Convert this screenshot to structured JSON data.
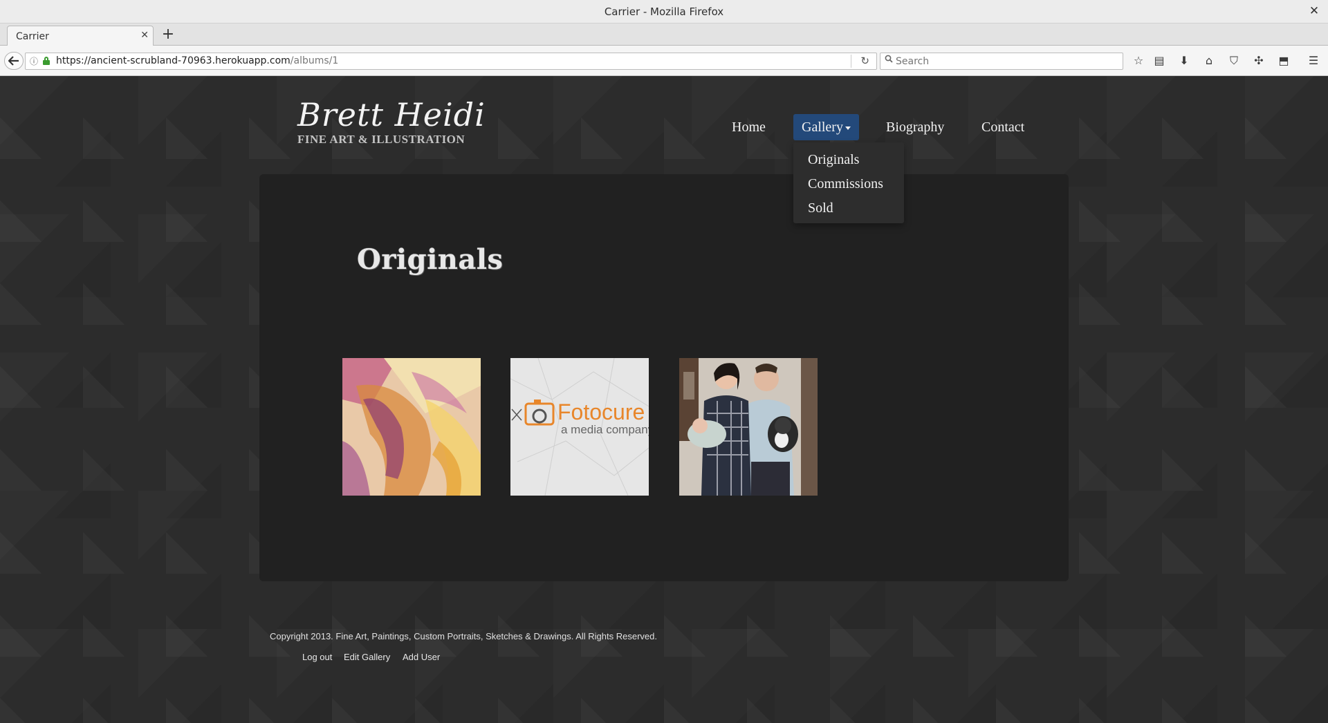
{
  "window": {
    "title": "Carrier - Mozilla Firefox",
    "close_glyph": "✕"
  },
  "tab": {
    "label": "Carrier",
    "close_glyph": "✕",
    "new_tab_glyph": "+"
  },
  "toolbar": {
    "back_glyph": "🡐",
    "info_glyph": "ⓘ",
    "url_host": "https://ancient-scrubland-70963.herokuapp.com",
    "url_path": "/albums/1",
    "reload_glyph": "↻",
    "search_placeholder": "Search",
    "search_glyph": "🔍",
    "icons": [
      {
        "name": "bookmark-star-icon",
        "glyph": "☆"
      },
      {
        "name": "reading-list-icon",
        "glyph": "▤"
      },
      {
        "name": "download-icon",
        "glyph": "⬇"
      },
      {
        "name": "home-icon",
        "glyph": "⌂"
      },
      {
        "name": "pocket-icon",
        "glyph": "⛉"
      },
      {
        "name": "extension-icon",
        "glyph": "✣"
      },
      {
        "name": "screenshot-icon",
        "glyph": "⬒"
      },
      {
        "name": "menu-icon",
        "glyph": "☰"
      }
    ]
  },
  "site": {
    "logo_script": "Brett Heidi",
    "logo_sub": "FINE ART & ILLUSTRATION",
    "nav": {
      "home": "Home",
      "gallery": "Gallery",
      "biography": "Biography",
      "contact": "Contact"
    },
    "dropdown": [
      "Originals",
      "Commissions",
      "Sold"
    ],
    "heading": "Originals",
    "thumbnails": [
      {
        "name": "horse-painting-thumbnail"
      },
      {
        "name": "fotocure-logo-thumbnail",
        "brand": "Fotocure",
        "tagline": "a media company"
      },
      {
        "name": "family-photo-thumbnail"
      }
    ],
    "footer": {
      "copyright": "Copyright 2013. Fine Art, Paintings, Custom Portraits, Sketches & Drawings. All Rights Reserved.",
      "links": [
        "Log out",
        "Edit Gallery",
        "Add User"
      ]
    }
  },
  "colors": {
    "accent": "#23497a",
    "page_bg": "#2c2c2c",
    "card_bg": "#212121",
    "fotocure_orange": "#e8862a"
  }
}
